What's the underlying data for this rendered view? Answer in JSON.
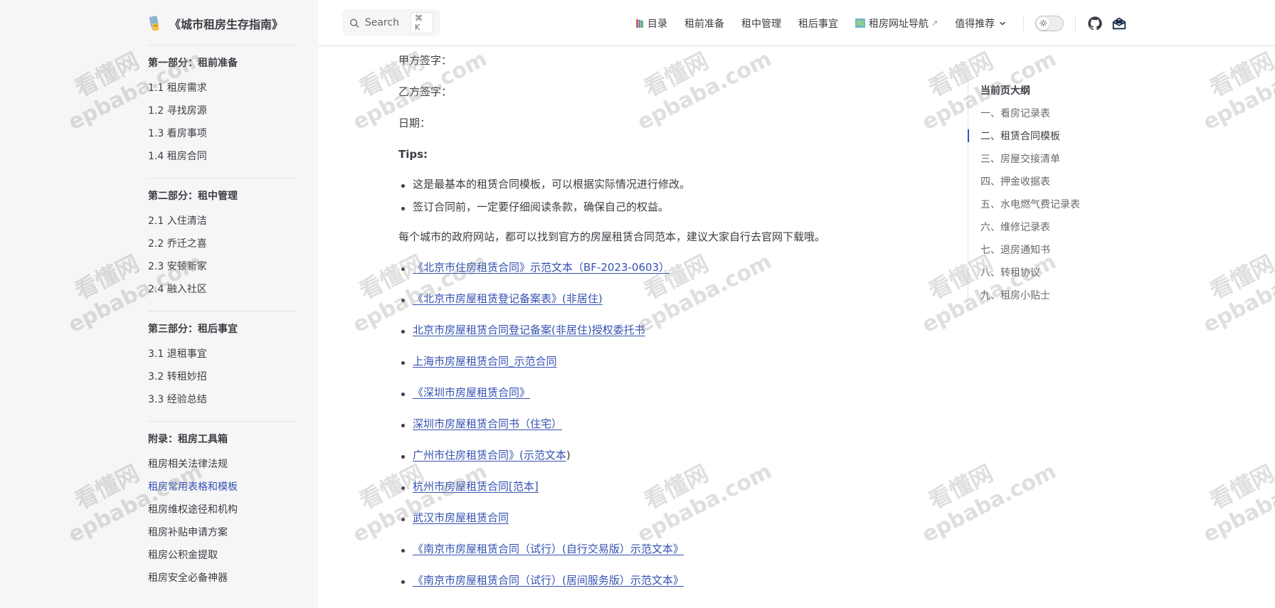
{
  "sidebar": {
    "title": "《城市租房生存指南》",
    "groups": [
      {
        "heading": "第一部分：租前准备",
        "items": [
          "1.1 租房需求",
          "1.2 寻找房源",
          "1.3 看房事项",
          "1.4 租房合同"
        ]
      },
      {
        "heading": "第二部分：租中管理",
        "items": [
          "2.1 入住清洁",
          "2.2 乔迁之喜",
          "2.3 安顿新家",
          "2.4 融入社区"
        ]
      },
      {
        "heading": "第三部分：租后事宜",
        "items": [
          "3.1 退租事宜",
          "3.2 转租妙招",
          "3.3 经验总结"
        ]
      },
      {
        "heading": "附录：租房工具箱",
        "items": [
          "租房相关法律法规",
          "租房常用表格和模板",
          "租房维权途径和机构",
          "租房补贴申请方案",
          "租房公积金提取",
          "租房安全必备神器"
        ]
      }
    ],
    "active_item": "租房常用表格和模板"
  },
  "nav": {
    "search_label": "Search",
    "search_kbd": "⌘ K",
    "links": [
      "目录",
      "租前准备",
      "租中管理",
      "租后事宜",
      "租房网址导航",
      "值得推荐"
    ],
    "external_marker": "↗"
  },
  "content": {
    "sign_a": "甲方签字：",
    "sign_b": "乙方签字：",
    "date": "日期：",
    "tips_title": "Tips:",
    "tips": [
      "这是最基本的租赁合同模板，可以根据实际情况进行修改。",
      "签订合同前，一定要仔细阅读条款，确保自己的权益。"
    ],
    "intro": "每个城市的政府网站，都可以找到官方的房屋租赁合同范本，建议大家自行去官网下载哦。",
    "links": [
      "《北京市住房租赁合同》示范文本（BF-2023-0603）",
      "《北京市房屋租赁登记备案表》(非居住)",
      "北京市房屋租赁合同登记备案(非居住)授权委托书",
      "上海市房屋租赁合同_示范合同",
      "《深圳市房屋租赁合同》",
      "深圳市房屋租赁合同书（住宅）",
      "广州市住房租赁合同》(示范文本",
      "杭州市房屋租赁合同[范本]",
      "武汉市房屋租赁合同",
      "《南京市房屋租赁合同（试行）(自行交易版）示范文本》",
      "《南京市房屋租赁合同（试行）(居间服务版）示范文本》"
    ],
    "link7_tail": ")"
  },
  "outline": {
    "title": "当前页大纲",
    "items": [
      "一、看房记录表",
      "二、租赁合同模板",
      "三、房屋交接清单",
      "四、押金收据表",
      "五、水电燃气费记录表",
      "六、维修记录表",
      "七、退房通知书",
      "八、转租协议",
      "九、租房小贴士"
    ],
    "active_index": 1
  },
  "watermark": {
    "line1": "看懂网",
    "line2": "epbaba.com"
  },
  "colors": {
    "accent": "#3451b2",
    "text": "#3c3c43",
    "muted": "#67676c",
    "sidebar_bg": "#f6f6f7",
    "border": "#e2e2e3"
  }
}
